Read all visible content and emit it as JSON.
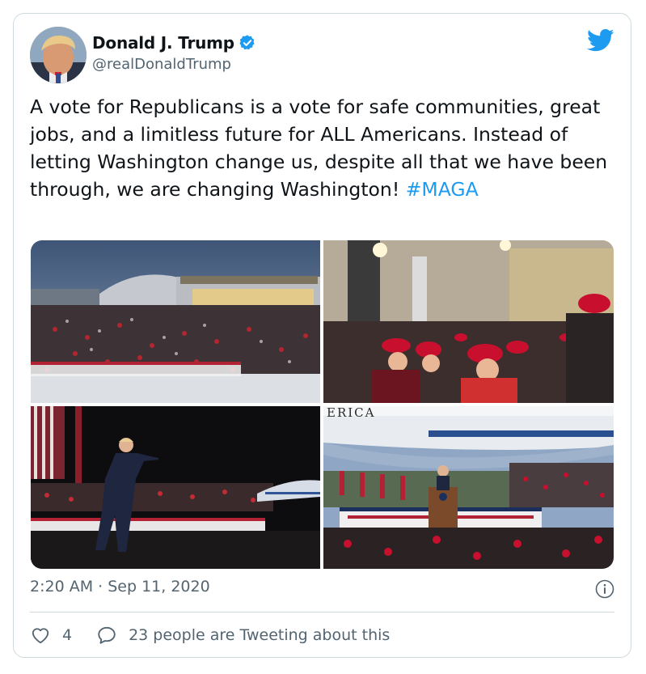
{
  "user": {
    "display_name": "Donald J. Trump",
    "handle": "@realDonaldTrump",
    "verified": true
  },
  "tweet": {
    "text": "A vote for Republicans is a vote for safe communities, great jobs, and a limitless future for ALL Americans. Instead of letting Washington change us, despite all that we have been through, we are changing Washington! ",
    "hashtag": "#MAGA",
    "timestamp": "2:20 AM · Sep 11, 2020"
  },
  "media": [
    {
      "scene": "rally-crowd-hangar-dusk"
    },
    {
      "scene": "crowd-red-hats-indoor"
    },
    {
      "scene": "speaker-pointing-night-rally"
    },
    {
      "scene": "podium-air-force-one"
    }
  ],
  "photo_text": {
    "plane_letters": "ERICA"
  },
  "engagement": {
    "likes": "4",
    "tweeting_label": "23 people are Tweeting about this"
  },
  "icons": [
    "verified-icon",
    "twitter-bird-icon",
    "info-icon",
    "heart-icon",
    "speech-bubble-icon"
  ],
  "colors": {
    "accent": "#1d9bf0",
    "text": "#0f1419",
    "secondary": "#536471",
    "border": "#cfd9de"
  }
}
